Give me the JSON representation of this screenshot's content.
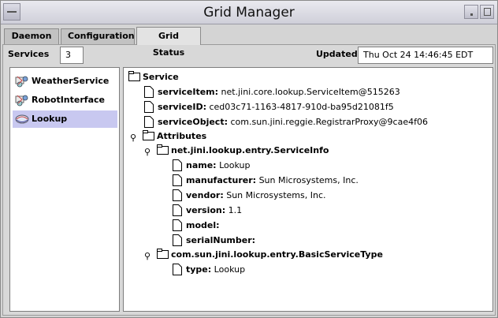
{
  "window": {
    "title": "Grid Manager"
  },
  "tabs": [
    "Daemon",
    "Configuration",
    "Grid Status"
  ],
  "header": {
    "services_label": "Services",
    "services_count": "3",
    "updated_label": "Updated",
    "updated_value": "Thu Oct 24 14:46:45 EDT 2002"
  },
  "services": [
    {
      "name": "WeatherService",
      "icon": "service-icon"
    },
    {
      "name": "RobotInterface",
      "icon": "service-icon"
    },
    {
      "name": "Lookup",
      "icon": "lookup-icon",
      "selected": true
    }
  ],
  "tree": {
    "root": "Service",
    "service_item": {
      "key": "serviceItem:",
      "value": "net.jini.core.lookup.ServiceItem@515263"
    },
    "service_id": {
      "key": "serviceID:",
      "value": "ced03c71-1163-4817-910d-ba95d21081f5"
    },
    "service_object": {
      "key": "serviceObject:",
      "value": "com.sun.jini.reggie.RegistrarProxy@9cae4f06"
    },
    "attributes": "Attributes",
    "service_info": {
      "label": "net.jini.lookup.entry.ServiceInfo",
      "name": {
        "key": "name:",
        "value": "Lookup"
      },
      "manufacturer": {
        "key": "manufacturer:",
        "value": "Sun Microsystems, Inc."
      },
      "vendor": {
        "key": "vendor:",
        "value": "Sun Microsystems, Inc."
      },
      "version": {
        "key": "version:",
        "value": "1.1"
      },
      "model": {
        "key": "model:",
        "value": ""
      },
      "serial": {
        "key": "serialNumber:",
        "value": ""
      }
    },
    "basic_service_type": {
      "label": "com.sun.jini.lookup.entry.BasicServiceType",
      "type": {
        "key": "type:",
        "value": "Lookup"
      }
    }
  }
}
